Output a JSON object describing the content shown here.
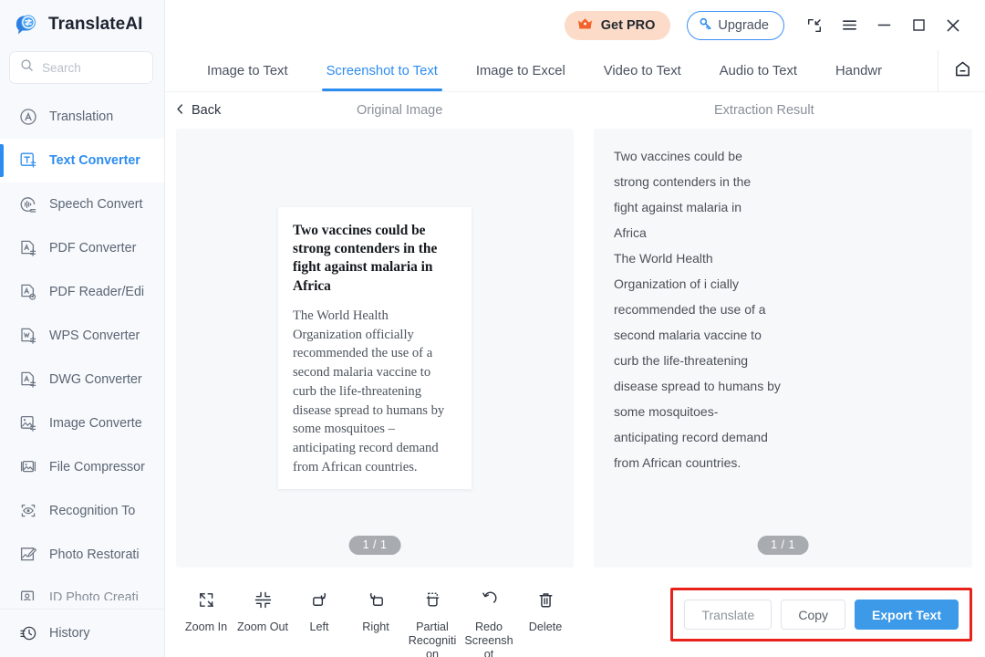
{
  "brand": {
    "name": "TranslateAI",
    "logo_icon": "speech-bubble-translate-icon"
  },
  "search": {
    "placeholder": "Search",
    "value": "",
    "icon": "search-icon"
  },
  "sidebar": {
    "items": [
      {
        "label": "Translation",
        "icon": "translation-icon",
        "active": false
      },
      {
        "label": "Text Converter",
        "icon": "text-converter-icon",
        "active": true
      },
      {
        "label": "Speech Convert",
        "icon": "speech-convert-icon",
        "active": false
      },
      {
        "label": "PDF Converter",
        "icon": "pdf-converter-icon",
        "active": false
      },
      {
        "label": "PDF Reader/Edi",
        "icon": "pdf-reader-edit-icon",
        "active": false
      },
      {
        "label": "WPS Converter",
        "icon": "wps-converter-icon",
        "active": false
      },
      {
        "label": "DWG Converter",
        "icon": "dwg-converter-icon",
        "active": false
      },
      {
        "label": "Image Converte",
        "icon": "image-converter-icon",
        "active": false
      },
      {
        "label": "File Compressor",
        "icon": "file-compressor-icon",
        "active": false
      },
      {
        "label": "Recognition To",
        "icon": "recognition-eye-icon",
        "active": false
      },
      {
        "label": "Photo Restorati",
        "icon": "photo-restoration-icon",
        "active": false
      },
      {
        "label": "ID Photo Creati",
        "icon": "id-photo-icon",
        "active": false
      }
    ],
    "footer": {
      "label": "History",
      "icon": "history-clock-icon"
    }
  },
  "titlebar": {
    "get_pro_label": "Get PRO",
    "get_pro_icon": "crown-icon",
    "get_pro_bg": "#fcdcc9",
    "upgrade_label": "Upgrade",
    "upgrade_icon": "key-icon",
    "upgrade_border": "#3b8ff5",
    "window_controls": [
      {
        "name": "collapse-icon"
      },
      {
        "name": "menu-icon"
      },
      {
        "name": "minimize-icon"
      },
      {
        "name": "maximize-icon"
      },
      {
        "name": "close-icon"
      }
    ]
  },
  "tabs": {
    "items": [
      {
        "label": "Image to Text",
        "active": false
      },
      {
        "label": "Screenshot to Text",
        "active": true
      },
      {
        "label": "Image to Excel",
        "active": false
      },
      {
        "label": "Video to Text",
        "active": false
      },
      {
        "label": "Audio to Text",
        "active": false
      },
      {
        "label": "Handwrit",
        "active": false
      }
    ],
    "home_icon": "home-icon",
    "accent": "#2d8cf0"
  },
  "subbar": {
    "back_label": "Back",
    "back_icon": "chevron-left-icon",
    "left_caption": "Original Image",
    "right_caption": "Extraction Result"
  },
  "original_image": {
    "doc_title": "Two vaccines could be strong contenders in the fight against malaria in Africa",
    "doc_body": "The World Health Organization officially recommended the use of a second malaria vaccine to curb the life-threatening disease spread to humans by some mosquitoes – anticipating record demand from African countries.",
    "page_indicator": "1 / 1"
  },
  "extraction_result": {
    "lines": [
      "Two vaccines could be",
      "strong contenders in the",
      "fight against malaria in",
      "Africa",
      "The World Health",
      "Organization of i cially",
      "recommended the use of a",
      "second malaria vaccine to",
      "curb the life-threatening",
      "disease spread to humans by",
      "some mosquitoes-",
      "anticipating record demand",
      "from African countries."
    ],
    "page_indicator": "1 / 1"
  },
  "toolbar": {
    "tools": [
      {
        "label": "Zoom In",
        "icon": "zoom-in-icon"
      },
      {
        "label": "Zoom Out",
        "icon": "zoom-out-icon"
      },
      {
        "label": "Left",
        "icon": "rotate-left-icon"
      },
      {
        "label": "Right",
        "icon": "rotate-right-icon"
      },
      {
        "label": "Partial Recognition",
        "icon": "partial-recognition-icon"
      },
      {
        "label": "Redo Screenshot",
        "icon": "redo-screenshot-icon"
      },
      {
        "label": "Delete",
        "icon": "delete-trash-icon"
      }
    ]
  },
  "actions": {
    "translate_label": "Translate",
    "copy_label": "Copy",
    "export_label": "Export Text",
    "export_bg": "#3d9ae8",
    "highlight_color": "#e8221b"
  }
}
